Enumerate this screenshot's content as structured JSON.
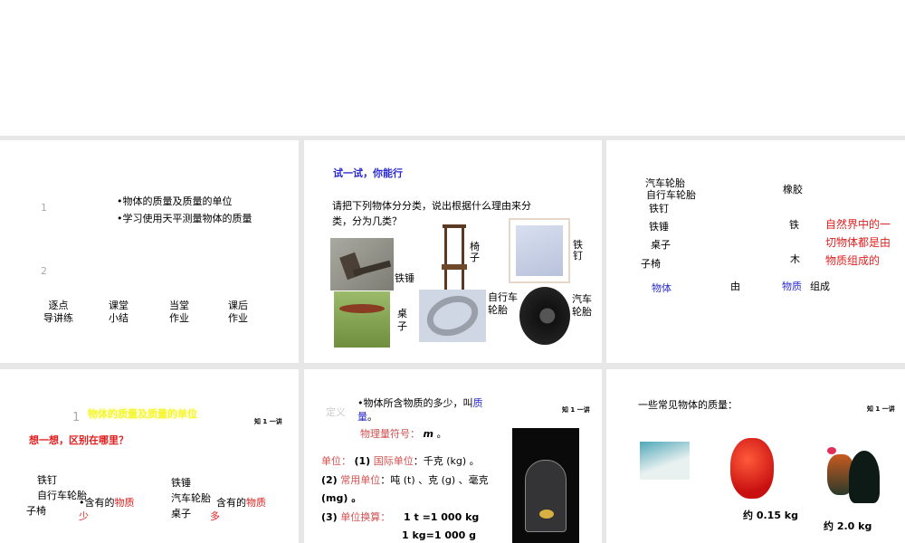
{
  "slides": [
    {
      "numbers": [
        "1",
        "2"
      ],
      "bullets": [
        "•物体的质量及质量的单位",
        "•学习使用天平测量物体的质量"
      ],
      "nav": [
        [
          "逐点",
          "导讲练"
        ],
        [
          "课堂",
          "小结"
        ],
        [
          "当堂",
          "作业"
        ],
        [
          "课后",
          "作业"
        ]
      ]
    },
    {
      "title": "试一试，你能行",
      "prompt_line1": "请把下列物体分分类，说出根据什么理由来分",
      "prompt_line2": "类，分为几类？",
      "labels": {
        "hammer": "铁锤",
        "chair": "椅\n子",
        "nails": "铁\n钉",
        "table": "桌\n子",
        "bike_tire": "自行车\n轮胎",
        "car_tire": "汽车\n轮胎"
      }
    },
    {
      "objects": [
        "汽车轮胎",
        "自行车轮胎",
        "铁钉",
        "铁锤",
        "桌子",
        "子椅"
      ],
      "materials": [
        "橡胶",
        "铁",
        "木"
      ],
      "sentence": {
        "object": "物体",
        "by": "由",
        "matter": "物质",
        "compose": "组成"
      },
      "conclusion": [
        "自然界中的一",
        "切物体都是由",
        "物质组成的"
      ]
    },
    {
      "number": "1",
      "heading": "物体的质量及质量的单位",
      "corner": "知 1 一讲",
      "question": "想一想，区别在哪里？",
      "left_items": [
        "铁钉",
        "自行车轮胎",
        "子椅"
      ],
      "left_note": "•含有的",
      "left_note_red": "物质",
      "left_note_red2": "少",
      "right_items": [
        "铁锤",
        "汽车轮胎",
        "桌子"
      ],
      "right_note": "含有的",
      "right_note_red": "物质",
      "right_note_red2": "多"
    },
    {
      "tag": "定义",
      "corner": "知 1 一讲",
      "def1": "•物体所含物质的多少，叫",
      "def_blue1": "质",
      "def_blue2": "量",
      "def_end": "。",
      "symbol_label": "物理量符号：",
      "symbol": "m",
      "symbol_end": "。",
      "unit_label": "单位：",
      "u1_num": "(1)",
      "u1_label": "国际单位",
      "u1_val": "：千克 (kg) 。",
      "u2_num": "(2)",
      "u2_label": "常用单位",
      "u2_val": "：吨 (t) 、克 (g) 、毫克",
      "u2_val2": "(mg) 。",
      "u3_num": "(3)",
      "u3_label": "单位换算：",
      "conv1": "1 t =1 000 kg",
      "conv2": "1 kg=1 000 g"
    },
    {
      "title": "一些常见物体的质量：",
      "corner": "知 1 一讲",
      "apple_mass": "约 0.15 kg",
      "rooster_mass": "约 2.0 kg"
    }
  ]
}
